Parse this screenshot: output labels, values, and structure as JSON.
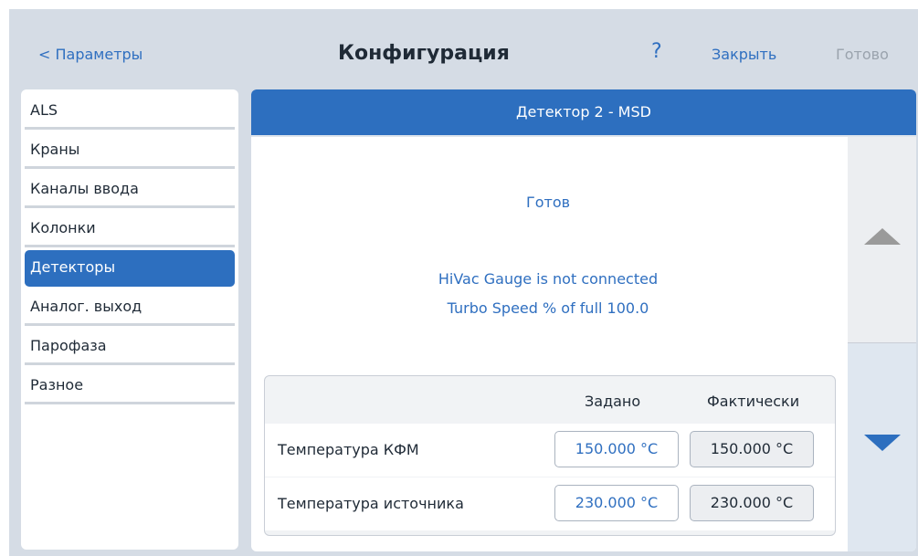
{
  "header": {
    "back_label": "< Параметры",
    "title": "Конфигурация",
    "help_label": "?",
    "close_label": "Закрыть",
    "done_label": "Готово"
  },
  "sidebar": {
    "items": [
      {
        "label": "ALS"
      },
      {
        "label": "Краны"
      },
      {
        "label": "Каналы ввода"
      },
      {
        "label": "Колонки"
      },
      {
        "label": "Детекторы",
        "selected": true
      },
      {
        "label": "Аналог. выход"
      },
      {
        "label": "Парофаза"
      },
      {
        "label": "Разное"
      }
    ]
  },
  "panel": {
    "title": "Детектор 2 - MSD",
    "status": "Готов",
    "messages": [
      "HiVac Gauge is not connected",
      "Turbo Speed % of full  100.0"
    ]
  },
  "table": {
    "col_set": "Задано",
    "col_actual": "Фактически",
    "rows": [
      {
        "label": "Температура КФМ",
        "setpoint": "150.000 °C",
        "actual": "150.000 °C"
      },
      {
        "label": "Температура источника",
        "setpoint": "230.000 °C",
        "actual": "230.000 °C"
      }
    ]
  },
  "colors": {
    "accent": "#2d6fbf",
    "link": "#2f6fc0",
    "background": "#d5dce5",
    "disabled": "#9aa3ad"
  },
  "icons": {
    "scroll_up": "triangle-up-icon",
    "scroll_down": "triangle-down-icon"
  }
}
